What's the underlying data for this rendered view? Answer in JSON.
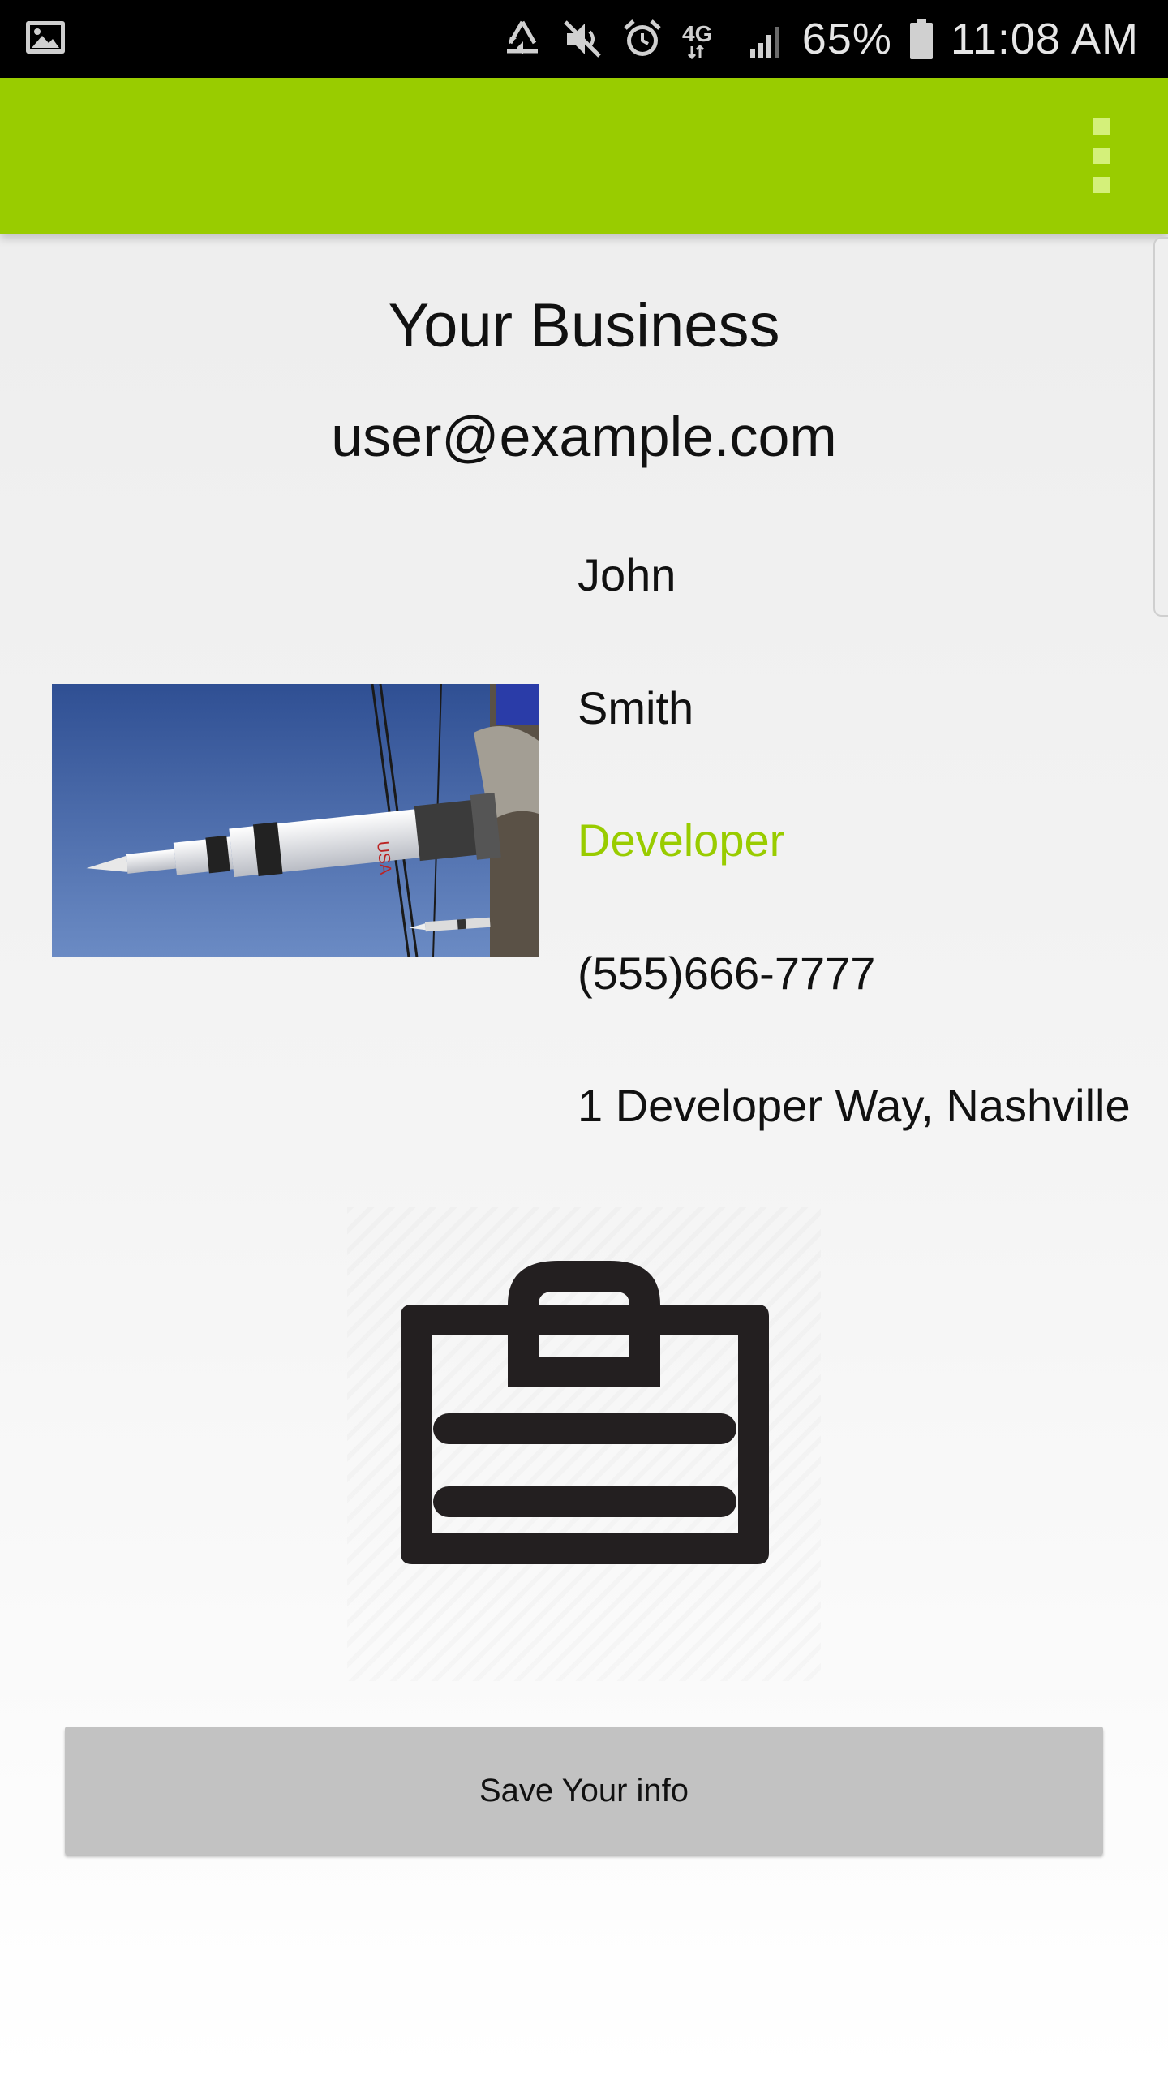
{
  "status_bar": {
    "battery": "65%",
    "time": "11:08 AM",
    "network": "4G",
    "icons": [
      "image-icon",
      "recycle-icon",
      "mute-icon",
      "alarm-icon",
      "network-4g-icon",
      "signal-icon",
      "battery-icon"
    ]
  },
  "app_bar": {
    "color": "#99cc00",
    "menu_icon": "overflow-menu-icon"
  },
  "business": {
    "name": "Your Business",
    "email": "user@example.com"
  },
  "person": {
    "first_name": "John",
    "last_name": "Smith",
    "title": "Developer",
    "phone": "(555)666-7777",
    "address": "1 Developer Way, Nashville"
  },
  "photo": {
    "icon": "rocket-photo",
    "lettering": "USA"
  },
  "center_icon": "id-badge-icon",
  "colors": {
    "accent": "#99cc00",
    "title_text": "#99cc00",
    "button_bg": "#c2c2c2"
  },
  "actions": {
    "save_label": "Save Your info"
  }
}
